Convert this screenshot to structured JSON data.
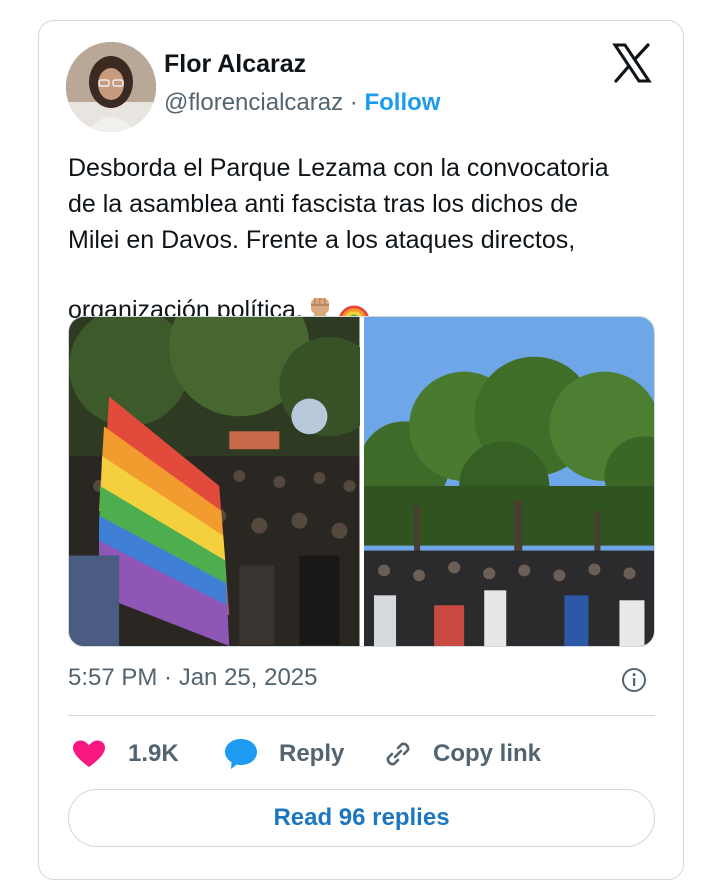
{
  "author": {
    "name": "Flor Alcaraz",
    "handle": "@florencialcaraz",
    "separator": "·",
    "follow_label": "Follow"
  },
  "platform_icon": "x-logo-icon",
  "tweet": {
    "text": "Desborda el Parque Lezama con la convocatoria\nde la asamblea anti fascista tras los dichos de\nMilei en Davos. Frente a los ataques directos,\norganización política.",
    "emojis": [
      "raised-fist-icon",
      "rainbow-icon"
    ]
  },
  "media": {
    "photos": [
      "crowd-with-rainbow-flag-photo",
      "crowd-under-trees-photo"
    ]
  },
  "timestamp": "5:57 PM · Jan 25, 2025",
  "actions": {
    "like_count": "1.9K",
    "reply_label": "Reply",
    "copy_link_label": "Copy link"
  },
  "read_replies_label": "Read 96 replies",
  "colors": {
    "accent": "#1d9bf0",
    "like": "#f91880",
    "reply_bubble": "#1d9bf0",
    "text_secondary": "#536471",
    "border": "#cfd9de"
  }
}
